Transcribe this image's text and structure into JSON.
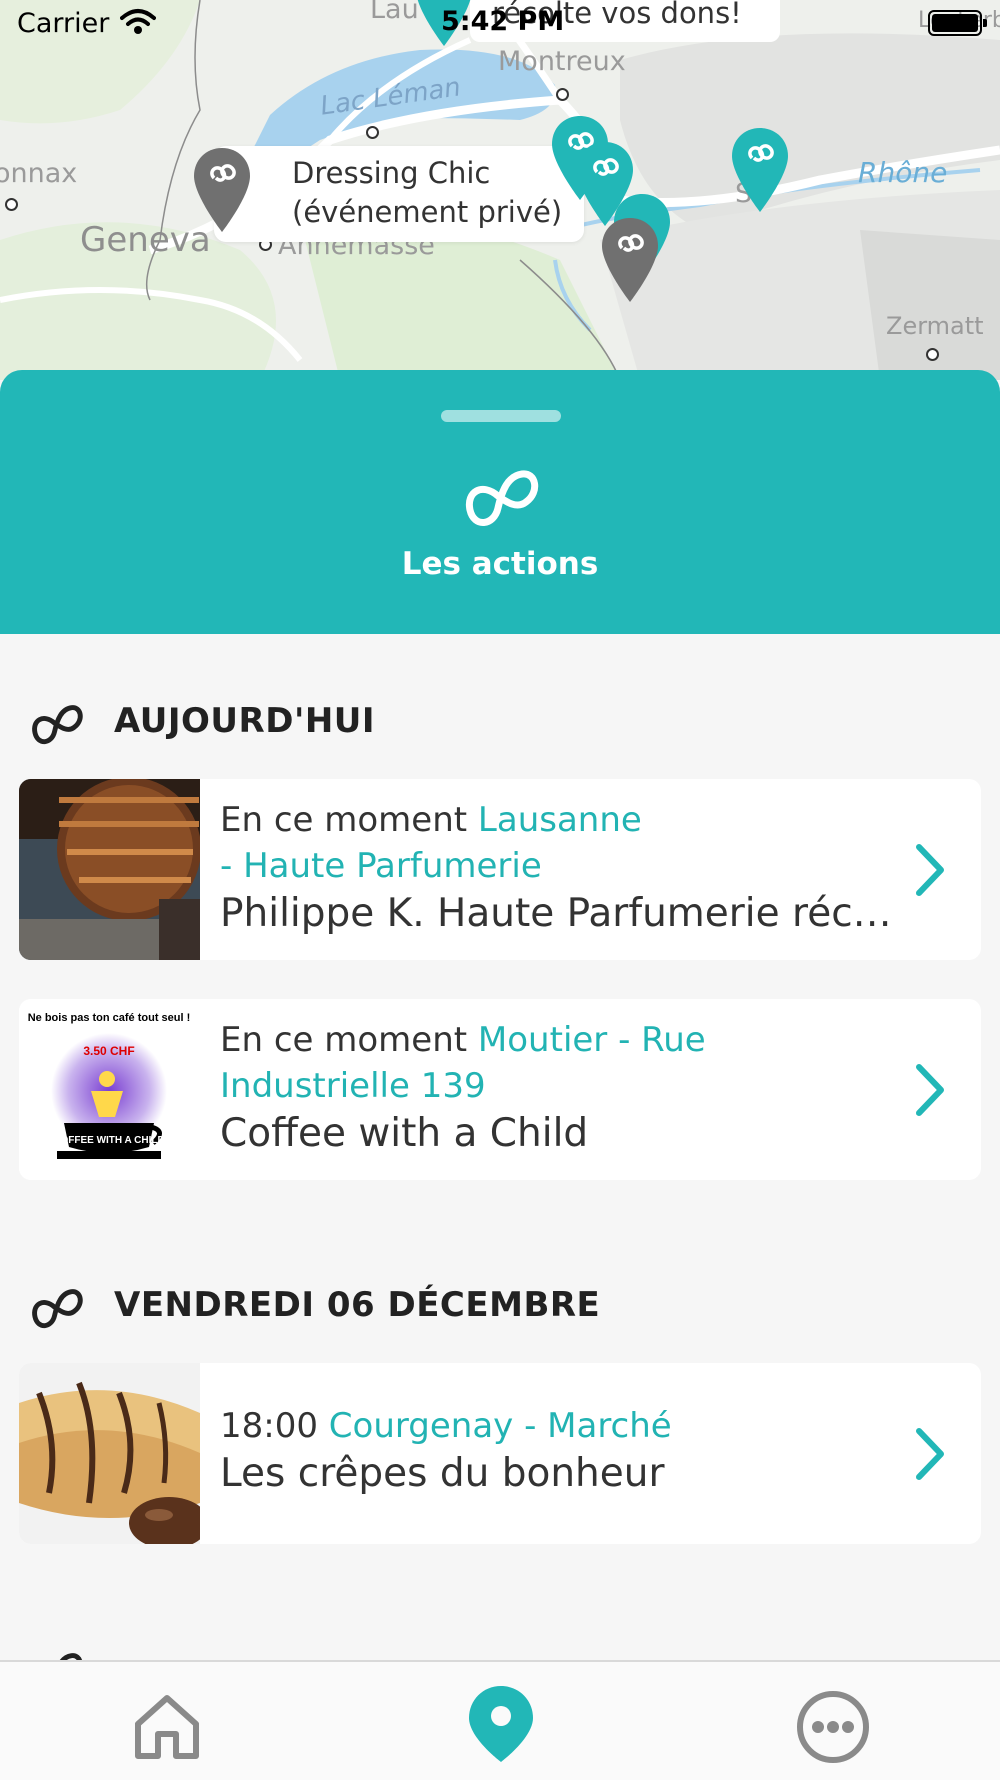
{
  "status_bar": {
    "carrier": "Carrier",
    "time": "5:42 PM"
  },
  "map": {
    "labels": {
      "lausanne": "Lau",
      "montreux": "Montreux",
      "lac_leman": "Lac Léman",
      "nyon": "onnax",
      "geneva": "Geneva",
      "annemasse": "Annemasse",
      "sion": "S",
      "rhone": "Rhône",
      "zermatt": "Zermatt",
      "leukerbad": "Leukerb"
    },
    "callout_main": {
      "line1": "Dressing Chic",
      "line2": "(événement privé)"
    },
    "callout_top": "récolte vos dons!"
  },
  "sheet": {
    "title": "Les actions",
    "accent_color": "#22b7b7"
  },
  "sections": [
    {
      "title": "AUJOURD'HUI",
      "items": [
        {
          "when": "En ce moment",
          "location": "Lausanne - Haute Parfumerie",
          "name": "Philippe K. Haute Parfumerie réco..."
        },
        {
          "when": "En ce moment",
          "location": "Moutier - Rue Industrielle 139",
          "name": "Coffee with a Child",
          "thumb_text": {
            "top": "Ne bois pas ton café tout seul !",
            "price": "3.50 CHF",
            "cup": "COFFEE WITH A CHILD"
          }
        }
      ]
    },
    {
      "title": "VENDREDI 06 DÉCEMBRE",
      "items": [
        {
          "when": "18:00",
          "location": "Courgenay - Marché",
          "name": "Les crêpes du bonheur"
        }
      ]
    }
  ],
  "tabbar": {
    "tabs": [
      {
        "icon": "home-icon",
        "active": false
      },
      {
        "icon": "map-pin-icon",
        "active": true
      },
      {
        "icon": "more-icon",
        "active": false
      }
    ],
    "active_color": "#22b7b7",
    "inactive_color": "#8a8a8a"
  }
}
